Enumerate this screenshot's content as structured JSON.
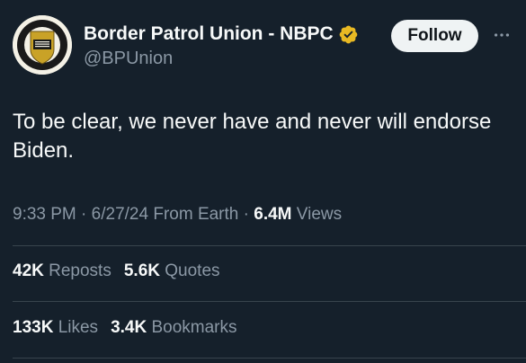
{
  "author": {
    "display_name": "Border Patrol Union - NBPC",
    "handle": "@BPUnion",
    "verified_badge_color": "#e8b923"
  },
  "actions": {
    "follow_label": "Follow",
    "more_icon": "more-horizontal-icon"
  },
  "tweet": {
    "text": "To be clear, we never have and never will endorse Biden."
  },
  "meta": {
    "time": "9:33 PM",
    "sep1": " · ",
    "date": "6/27/24",
    "source": " From Earth",
    "sep2": " · ",
    "views_count": "6.4M",
    "views_label": " Views"
  },
  "stats": {
    "reposts_count": "42K",
    "reposts_label": " Reposts",
    "quotes_count": "5.6K",
    "quotes_label": " Quotes",
    "likes_count": "133K",
    "likes_label": " Likes",
    "bookmarks_count": "3.4K",
    "bookmarks_label": " Bookmarks"
  },
  "colors": {
    "background": "#15202b",
    "text_primary": "#f7f9f9",
    "text_secondary": "#8b98a5",
    "divider": "#38444d"
  }
}
